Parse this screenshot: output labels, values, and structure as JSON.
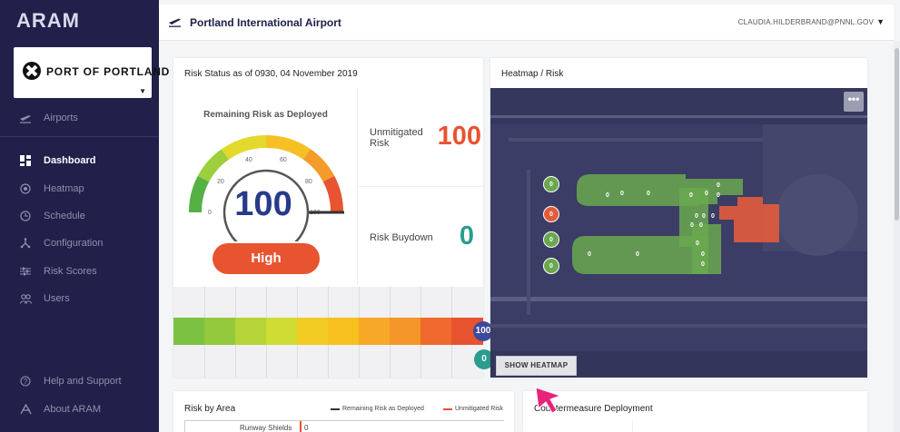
{
  "app": {
    "logo": "ARAM",
    "org_name": "PORT OF PORTLAND"
  },
  "topbar": {
    "title": "Portland International Airport",
    "user": "CLAUDIA.HILDERBRAND@PNNL.GOV"
  },
  "sidebar": {
    "airports": "Airports",
    "items": [
      {
        "label": "Dashboard",
        "icon": "dashboard-icon",
        "active": true
      },
      {
        "label": "Heatmap",
        "icon": "heatmap-icon",
        "active": false
      },
      {
        "label": "Schedule",
        "icon": "clock-icon",
        "active": false
      },
      {
        "label": "Configuration",
        "icon": "network-icon",
        "active": false
      },
      {
        "label": "Risk Scores",
        "icon": "sliders-icon",
        "active": false
      },
      {
        "label": "Users",
        "icon": "users-icon",
        "active": false
      }
    ],
    "help": "Help and Support",
    "about": "About ARAM"
  },
  "risk_status": {
    "title": "Risk Status as of 0930, 04 November 2019",
    "gauge_title": "Remaining Risk as Deployed",
    "gauge_value": "100",
    "gauge_ticks": [
      "0",
      "20",
      "40",
      "60",
      "80",
      "100"
    ],
    "level": "High",
    "unmitigated_label": "Unmitigated Risk",
    "unmitigated_value": "100",
    "buydown_label": "Risk Buydown",
    "buydown_value": "0",
    "strip_badge_high": "100",
    "strip_badge_low": "0",
    "colors": {
      "high": "#e85330",
      "teal": "#2a9d8f",
      "navy": "#283a8a"
    }
  },
  "heatmap": {
    "title": "Heatmap / Risk",
    "more": "•••",
    "show_button": "SHOW HEATMAP",
    "zone_value": "0",
    "zone_high_value": "0"
  },
  "risk_by_area": {
    "title": "Risk by Area",
    "legend_remaining": "Remaining Risk as Deployed",
    "legend_unmitigated": "Unmitigated Risk",
    "row_label": "Runway Shields",
    "row_value": "0"
  },
  "countermeasure": {
    "title": "Countermeasure Deployment"
  }
}
